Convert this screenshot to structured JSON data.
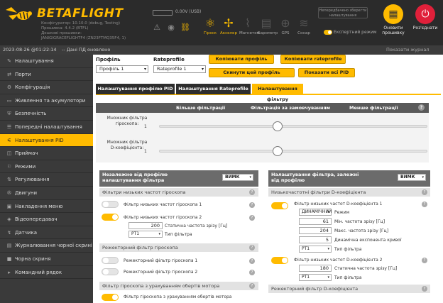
{
  "header": {
    "logo_text": "BETAFLIGHT",
    "config_lines": [
      "Конфігуратор: 10.10.0 (debug, Testing)",
      "Прошивка: 4.4.2 (BTFL)",
      "Дошкові прошивки:",
      "JANIGIGRACEFLIGHTF4 (ZN23FTMQ35F4, 1)"
    ],
    "battery_text": "0.00V (USB)",
    "sensors": [
      {
        "label": "Гіроск",
        "icon": "gyro-icon",
        "state": "on"
      },
      {
        "label": "Акселер",
        "icon": "accel-icon",
        "state": "on"
      },
      {
        "label": "Магнетом",
        "icon": "mag-icon",
        "state": "off"
      },
      {
        "label": "Барометр",
        "icon": "baro-icon",
        "state": "off"
      },
      {
        "label": "GPS",
        "icon": "gps-icon",
        "state": "off"
      },
      {
        "label": "Сонар",
        "icon": "sonar-icon",
        "state": "off"
      }
    ],
    "save_notice": "Непередбачено зберегти налаштування",
    "expert_mode": "Експертний режим",
    "update_button": "Оновити прошивку",
    "disconnect_button": "Роз'єднати",
    "colors": {
      "accent": "#ffbb00",
      "disconnect": "#e0203a"
    }
  },
  "status": {
    "datetime": "2023-08-26 @01:22:14",
    "message": "-- Дані ПД оновлено",
    "log_link": "Показати журнал подій"
  },
  "sidebar": {
    "items": [
      {
        "label": "Налаштування",
        "icon": "wrench-icon"
      },
      {
        "label": "Порти",
        "icon": "ports-icon"
      },
      {
        "label": "Конфігурація",
        "icon": "gear-icon"
      },
      {
        "label": "Живлення та акумулятори",
        "icon": "battery-icon"
      },
      {
        "label": "Безпечність",
        "icon": "shield-icon"
      },
      {
        "label": "Попередні налаштування",
        "icon": "presets-icon"
      },
      {
        "label": "Налаштування PID",
        "icon": "pid-icon",
        "active": true
      },
      {
        "label": "Приймач",
        "icon": "receiver-icon"
      },
      {
        "label": "Режими",
        "icon": "modes-icon"
      },
      {
        "label": "Регулювання",
        "icon": "adjust-icon"
      },
      {
        "label": "Двигуни",
        "icon": "motor-icon"
      },
      {
        "label": "Накладення меню",
        "icon": "osd-icon"
      },
      {
        "label": "Відеопередавач",
        "icon": "vtx-icon"
      },
      {
        "label": "Датчика",
        "icon": "sensor-icon"
      },
      {
        "label": "Журналювання чорної скрині",
        "icon": "log-icon"
      },
      {
        "label": "Чорна скриня",
        "icon": "blackbox-icon"
      },
      {
        "label": "Командний рядок",
        "icon": "cli-icon"
      }
    ]
  },
  "main": {
    "profile_label": "Профіль",
    "profile_value": "Профіль 1",
    "rateprofile_label": "Rateprofile",
    "rateprofile_value": "Rateprofile 1",
    "buttons": {
      "copy_profile": "Копіювати профіль",
      "copy_rateprofile": "Копіювати rateprofile",
      "reset_profile": "Скинути цей профіль",
      "show_all_pid": "Показати всі PID"
    },
    "tabs": [
      "Налаштування профілю PID",
      "Налаштування Rateprofile",
      "Налаштування фільтру"
    ],
    "slider_panel": {
      "col_low": "Більше фільтрації",
      "col_mid": "Фільтрація за замовчуванням",
      "col_high": "Менше фільтрації",
      "rows": [
        {
          "label": "Множник фільтра гіроскопа:",
          "value": "1"
        },
        {
          "label": "Множник фільтра D-коефіцієнта:",
          "value": "1"
        }
      ]
    },
    "left_panel": {
      "title": "Незалежно від профілю налаштування фільтра",
      "toggle_label": "ВИМК",
      "section1": "Фільтри низьких частот гіроскопа",
      "lp1_label": "Фільтр низьких частот гіроскопа 1",
      "lp2_label": "Фільтр низьких частот гіроскопа 2",
      "lp2_freq": "200",
      "lp2_freq_label": "Статична частота зрізу [Гц]",
      "lp2_type": "PT1",
      "lp2_type_label": "Тип фільтра",
      "section2": "Режекторний фільтр гіроскопа",
      "notch1_label": "Режекторний фільтр гіроскопа 1",
      "notch2_label": "Режекторний фільтр гіроскопа 2",
      "section3": "Фільтр гіроскопа з урахуванням обертів мотора",
      "rpm_label": "Фільтр гіроскопа з урахуванням обертів мотора"
    },
    "right_panel": {
      "title": "Налаштування фільтра, залежні від профілю",
      "toggle_label": "ВИМК",
      "section1": "Низькочастотні фільтри D-коефіцієнта",
      "dlp1_label": "Фільтр низьких частот D-коефіцієнта 1",
      "dlp1_mode": "ДИНАМІЧНИЙ",
      "dlp1_mode_label": "Режим",
      "dlp1_min": "61",
      "dlp1_min_label": "Мін. частота зрізу [Гц]",
      "dlp1_max": "204",
      "dlp1_max_label": "Макс. частота зрізу [Гц]",
      "dlp1_expo": "5",
      "dlp1_expo_label": "Динамічна експонента кривої",
      "dlp1_type": "PT1",
      "dlp1_type_label": "Тип фільтра",
      "dlp2_label": "Фільтр низьких частот D-коефіцієнта 2",
      "dlp2_freq": "180",
      "dlp2_freq_label": "Статична частота зрізу [Гц]",
      "dlp2_type": "PT1",
      "dlp2_type_label": "Тип фільтра",
      "section2": "Режекторний фільтр D-коефіцієнта"
    }
  }
}
